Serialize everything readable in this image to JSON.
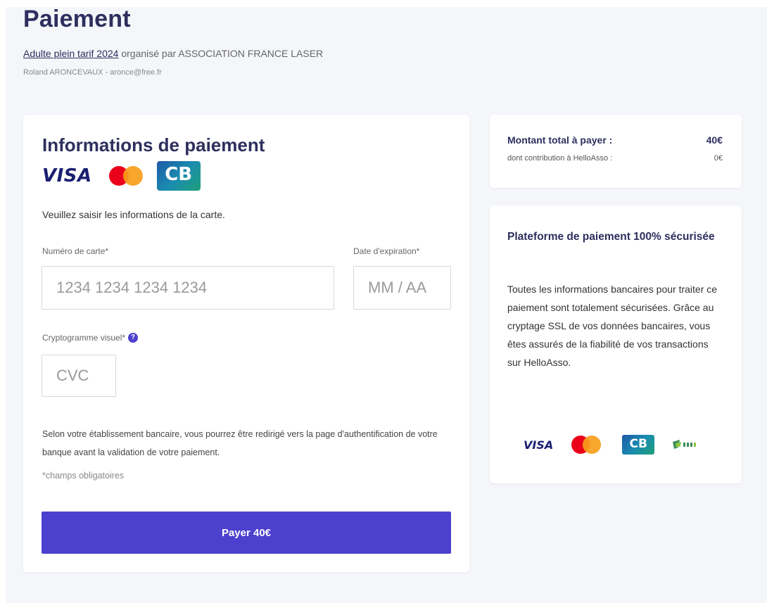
{
  "header": {
    "title": "Paiement",
    "event_link": "Adulte plein tarif 2024",
    "organized_by": "organisé par ASSOCIATION FRANCE LASER",
    "user_line": "Roland ARONCEVAUX - aronce@free.fr"
  },
  "payment_form": {
    "title": "Informations de paiement",
    "brands": {
      "visa": "VISA",
      "mastercard_icon": "mastercard-icon",
      "cb": "CB"
    },
    "intro": "Veuillez saisir les informations de la carte.",
    "card_number_label": "Numéro de carte*",
    "card_number_placeholder": "1234 1234 1234 1234",
    "expiry_label": "Date d'expiration*",
    "expiry_placeholder": "MM / AA",
    "cvc_label": "Cryptogramme visuel*",
    "cvc_help_icon": "help-icon",
    "cvc_placeholder": "CVC",
    "bank_notice": "Selon votre établissement bancaire, vous pourrez être redirigé vers la page d'authentification de votre banque avant la validation de votre paiement.",
    "required_note": "*champs obligatoires",
    "pay_button": "Payer 40€"
  },
  "summary": {
    "total_label": "Montant total à payer :",
    "total_value": "40€",
    "contribution_label": "dont contribution à HelloAsso :",
    "contribution_value": "0€"
  },
  "security": {
    "title": "Plateforme de paiement 100% sécurisée",
    "text": "Toutes les informations bancaires pour traiter ce paiement sont totalement sécurisées. Grâce au cryptage SSL de vos données bancaires, vous êtes assurés de la fiabilité de vos transactions sur HelloAsso.",
    "logos": {
      "visa": "VISA",
      "cb": "CB",
      "pci_icon": "pci-dss-icon"
    }
  },
  "colors": {
    "primary": "#4c40cf",
    "title": "#2e2f5e",
    "background": "#f4f6fa"
  }
}
